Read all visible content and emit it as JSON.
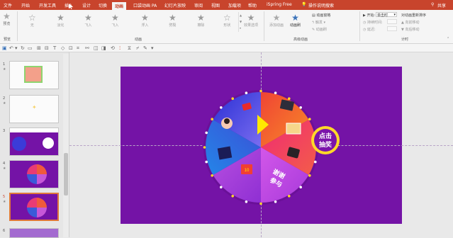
{
  "ribbon_tabs": [
    "文件",
    "开始",
    "开发工具",
    "插入",
    "设计",
    "切换",
    "动画",
    "口袋动画 PA",
    "幻灯片放映",
    "审阅",
    "视图",
    "加载项",
    "帮助",
    "iSpring Free",
    "操作说明搜索"
  ],
  "share_label": "共享",
  "preview": {
    "label": "预览",
    "group": "预览"
  },
  "animations": [
    "无",
    "淡化",
    "飞入",
    "飞入",
    "浮入",
    "劈裂",
    "擦除",
    "形状"
  ],
  "effect_options": "效果选项",
  "animation_group": "动画",
  "advanced": {
    "add_animation": "添加动画",
    "animation_pane": "动画窗格",
    "trigger": "触发",
    "painter": "动画刷",
    "group": "高级动画"
  },
  "timing": {
    "start_label": "开始:",
    "start_value": "单击时",
    "duration_label": "持续时间:",
    "delay_label": "延迟:",
    "reorder": "对动画重新排序",
    "move_earlier": "向前移动",
    "move_later": "向后移动",
    "group": "计时"
  },
  "slides": [
    {
      "num": "1",
      "star": "★"
    },
    {
      "num": "2",
      "star": "★"
    },
    {
      "num": "3",
      "star": ""
    },
    {
      "num": "4",
      "star": "★"
    },
    {
      "num": "5",
      "star": "★"
    },
    {
      "num": "6",
      "star": ""
    }
  ],
  "wheel": {
    "button_line1": "点击",
    "button_line2": "抽奖",
    "sector_text_line1": "谢谢",
    "sector_text_line2": "参与",
    "badge_text": "10"
  },
  "colors": {
    "ribbon_red": "#c8442c",
    "slide_purple": "#7413a6",
    "ring_purple": "#6a1098",
    "dot_yellow": "#ffd829"
  }
}
